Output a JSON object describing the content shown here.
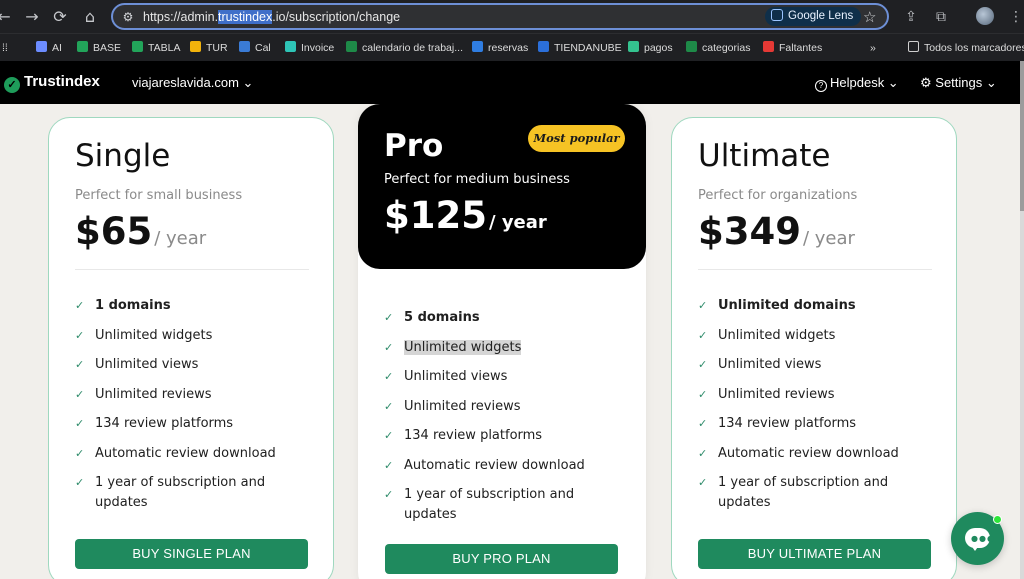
{
  "browser": {
    "url_prefix": "https://admin.",
    "url_highlight": "trustindex",
    "url_suffix": ".io/subscription/change",
    "lens_label": "Google Lens",
    "bookmarks": [
      {
        "label": "AI",
        "color": "#6c8cff"
      },
      {
        "label": "BASE",
        "color": "#22a45a"
      },
      {
        "label": "TABLA",
        "color": "#22a45a"
      },
      {
        "label": "TUR",
        "color": "#f2b30c"
      },
      {
        "label": "Cal",
        "color": "#3a7bd5"
      },
      {
        "label": "Invoice",
        "color": "#2ec4b6"
      },
      {
        "label": "calendario de trabaj...",
        "color": "#1e8a48"
      },
      {
        "label": "reservas",
        "color": "#2f7de1"
      },
      {
        "label": "TIENDANUBE",
        "color": "#2b6fd9"
      },
      {
        "label": "pagos",
        "color": "#34c38f"
      },
      {
        "label": "categorias",
        "color": "#1e8a48"
      },
      {
        "label": "Faltantes",
        "color": "#e53935"
      }
    ],
    "overflow_label": "»",
    "all_bookmarks_label": "Todos los marcadores"
  },
  "header": {
    "logo_text": "Trustindex",
    "domain": "viajareslavida.com ⌄",
    "helpdesk": "Helpdesk ⌄",
    "settings": "Settings ⌄"
  },
  "plans": {
    "single": {
      "name": "Single",
      "tagline": "Perfect for small business",
      "price": "$65",
      "period": "/ year",
      "features": [
        "1 domains",
        "Unlimited widgets",
        "Unlimited views",
        "Unlimited reviews",
        "134 review platforms",
        "Automatic review download",
        "1 year of subscription and updates"
      ],
      "button": "BUY SINGLE PLAN"
    },
    "pro": {
      "name": "Pro",
      "badge": "Most popular",
      "tagline": "Perfect for medium business",
      "price": "$125",
      "period": "/ year",
      "features": [
        "5 domains",
        "Unlimited widgets",
        "Unlimited views",
        "Unlimited reviews",
        "134 review platforms",
        "Automatic review download",
        "1 year of subscription and updates"
      ],
      "button": "BUY PRO PLAN"
    },
    "ultimate": {
      "name": "Ultimate",
      "tagline": "Perfect for organizations",
      "price": "$349",
      "period": "/ year",
      "features": [
        "Unlimited domains",
        "Unlimited widgets",
        "Unlimited views",
        "Unlimited reviews",
        "134 review platforms",
        "Automatic review download",
        "1 year of subscription and updates"
      ],
      "button": "BUY ULTIMATE PLAN"
    }
  },
  "colors": {
    "accent_green": "#1f8a5e",
    "badge_yellow": "#f6c324",
    "card_border": "#9fd8bf"
  },
  "icons": {
    "check": "check-icon",
    "chat": "chat-icon"
  }
}
